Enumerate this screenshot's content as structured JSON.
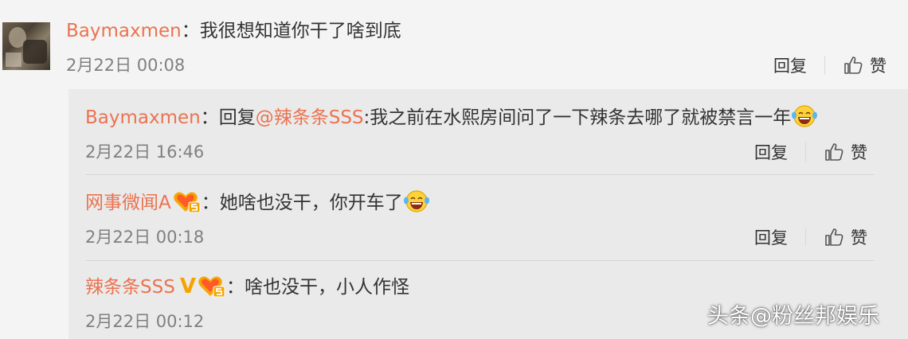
{
  "comment": {
    "user": "Baymaxmen",
    "separator": "：",
    "text": "我很想知道你干了啥到底",
    "date": "2月22日 00:08",
    "reply_label": "回复",
    "like_label": "赞"
  },
  "replies": [
    {
      "user": "Baymaxmen",
      "separator": "：",
      "reply_prefix": "回复",
      "mention": "@辣条条SSS",
      "text": ":我之前在水熙房间问了一下辣条去哪了就被禁言一年",
      "emoji": "laughing-tears-emoji",
      "date": "2月22日 16:46",
      "reply_label": "回复",
      "like_label": "赞"
    },
    {
      "user": "网事微闻A",
      "separator": "：",
      "text": "她啥也没干，你开车了",
      "emoji": "laughing-tears-emoji",
      "date": "2月22日 00:18",
      "reply_label": "回复",
      "like_label": "赞"
    },
    {
      "user": "辣条条SSS",
      "verified_mark": "V",
      "separator": "：",
      "text": "啥也没干，小人作怪",
      "date": "2月22日 00:12"
    }
  ],
  "watermark": "头条@粉丝邦娱乐",
  "colors": {
    "username": "#eb7350",
    "text": "#333333",
    "date": "#808080",
    "background": "#f4f4f4",
    "reply_area": "#eaeaea"
  }
}
